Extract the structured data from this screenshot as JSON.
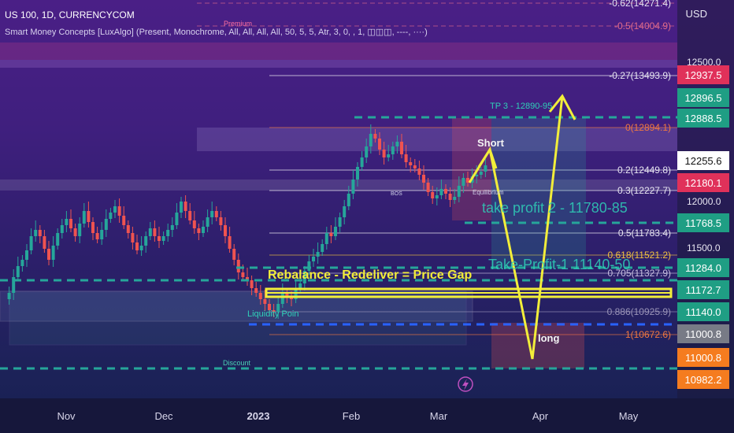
{
  "header": {
    "symbol_line": "US 100, 1D, CURRENCYCOM",
    "indicator_line": "Smart Money Concepts [LuxAlgo] (Present, Monochrome, All, All, All, All, 50, 5, 5, Atr, 3, 0, , 1, ◫◫◫, ----, ····)",
    "currency": "USD"
  },
  "chart_data": {
    "type": "candlestick",
    "price_axis": {
      "ticks": [
        "12500.0",
        "12000.0",
        "11500.0",
        "11000.0"
      ]
    },
    "time_axis": {
      "labels": [
        "Nov",
        "Dec",
        "2023",
        "Feb",
        "Mar",
        "Apr",
        "May"
      ]
    },
    "fib_levels": [
      {
        "label": "-0.62(14271.4)",
        "color": "#e8e6f2"
      },
      {
        "label": "-0.5(14004.9)",
        "color": "#e06a8a"
      },
      {
        "label": "-0.27(13493.9)",
        "color": "#e8e6f2"
      },
      {
        "label": "0(12894.1)",
        "color": "#f07840"
      },
      {
        "label": "0.2(12449.8)",
        "color": "#e8e6f2"
      },
      {
        "label": "0.3(12227.7)",
        "color": "#e8e6f2"
      },
      {
        "label": "0.5(11783.4)",
        "color": "#e8e6f2"
      },
      {
        "label": "0.618(11521.2)",
        "color": "#f0c040"
      },
      {
        "label": "0.705(11327.9)",
        "color": "#c8c0e0"
      },
      {
        "label": "0.886(10925.9)",
        "color": "#9a94b8"
      },
      {
        "label": "1(10672.6)",
        "color": "#f07840"
      }
    ],
    "price_badges": [
      {
        "value": "12937.5",
        "color": "#e0315a"
      },
      {
        "value": "12896.5",
        "color": "#1f9e84"
      },
      {
        "value": "12888.5",
        "color": "#1f9e84"
      },
      {
        "value": "12255.6",
        "color": "#ffffff"
      },
      {
        "value": "12180.1",
        "color": "#e0315a"
      },
      {
        "value": "11768.5",
        "color": "#1f9e84"
      },
      {
        "value": "11284.0",
        "color": "#1f9e84"
      },
      {
        "value": "11172.7",
        "color": "#1f9e84"
      },
      {
        "value": "11140.0",
        "color": "#1f9e84"
      },
      {
        "value": "11000.8",
        "color": "#787b86"
      },
      {
        "value": "11000.8",
        "color": "#f57c1f"
      },
      {
        "value": "10982.2",
        "color": "#f57c1f"
      }
    ],
    "annotations": {
      "premium": "Premium",
      "discount": "Discount",
      "equilibrium": "Equilibrium",
      "bos": "BOS",
      "liquidity": "Liquidity Poin",
      "tp3": "TP 3 - 12890-95",
      "take_profit_2": "take profit 2 - 11780-85",
      "take_profit_1": "Take-Profit-1 11140-50",
      "gap_label": "Rebalance - Redeliver = Price Gap",
      "short": "Short",
      "long": "long"
    },
    "colors": {
      "bull": "#26a69a",
      "bear": "#ef5350",
      "arrow": "#f2ee3a",
      "dashed_green": "#26a69a",
      "dashed_blue": "#2962ff"
    }
  }
}
